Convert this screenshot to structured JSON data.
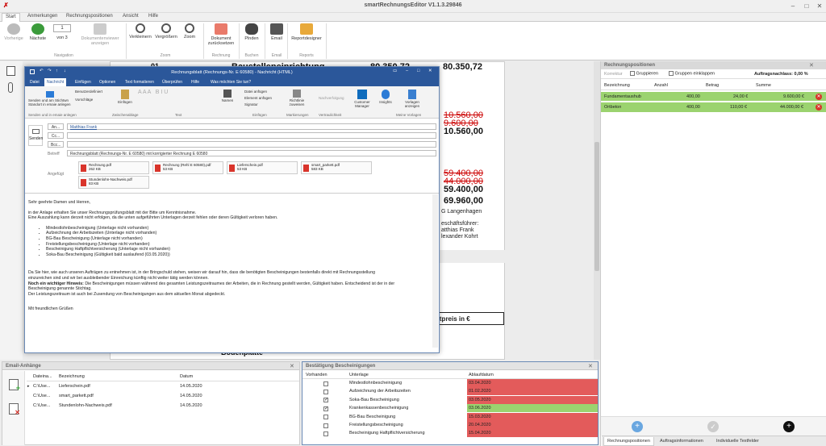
{
  "app": {
    "title": "smartRechnungsEditor  V1.1.3.29846"
  },
  "menu": [
    "Start",
    "Anmerkungen",
    "Rechnungspositionen",
    "Ansicht",
    "Hilfe"
  ],
  "ribbon": {
    "buttons": [
      "Vorherige",
      "Nächste",
      "von 3",
      "Dokumentenviewer anzeigen",
      "Verkleinern",
      "Vergrößern",
      "Zoom",
      "Dokument zurücksetzen",
      "Plnden",
      "Email",
      "Reportdesigner"
    ],
    "page_value": "1",
    "groups": [
      "Navigation",
      "Zoom",
      "Rechnung",
      "Buchen",
      "Email",
      "Reports"
    ]
  },
  "document": {
    "line1_pos": "01",
    "line1_text": "Baustelleneinrichtung",
    "line1_val1": "80.350,72",
    "line1_val2": "80.350,72",
    "v1": "10.560,00",
    "v1_strike": "9.600,00",
    "v1_total": "10.560,00",
    "v2": "59.400,00",
    "v2_strike": "44.000,00",
    "v2_total": "59.400,00",
    "v3": "69.960,00",
    "addr1": "G Langenhagen",
    "addr2": "eschäftsführer:",
    "addr3": "atthias Frank",
    "addr4": "lexander Kohrt",
    "preis": "ntpreis in €",
    "bodenplatte": "Bodenplatte"
  },
  "outlook": {
    "title": "Rechnungsblatt (Rechnungs-Nr. E 60580)  -  Nachricht (HTML)",
    "tabs": [
      "Datei",
      "Nachricht",
      "Einfügen",
      "Optionen",
      "Text formatieren",
      "Überprüfen",
      "Hilfe",
      "Was möchten Sie tun?"
    ],
    "ribbon_items": [
      "Senden und am Stichtwn Standort in emaie anlegen",
      "Benutzerdefiniert",
      "Vorschläge",
      "Einfügen",
      "Namen",
      "Datei anfügen",
      "Element anfügen",
      "Signatur",
      "Richtlinie zuweisen",
      "Nachverfolgung",
      "Customer Manager",
      "Insights",
      "Vorlagen anzeigen"
    ],
    "ribbon_groups": [
      "Senden und in emaie anlegen",
      "Zwischenablage",
      "Text",
      "Einfügen",
      "Markierungen",
      "Vertraulichkeit",
      "Meine Vorlagen"
    ],
    "send_label": "Senden",
    "to_label": "An...",
    "cc_label": "Cc...",
    "bcc_label": "Bcc...",
    "subject_label": "Betreff",
    "attach_label": "Angefügt",
    "to_value": "Matthias Frank",
    "subject_value": "Rechnungsblatt (Rechnungs-Nr. E 60580) mit korrigierter Rechnung E 60580",
    "attachments": [
      {
        "name": "Rechnung.pdf",
        "size": "262 KB"
      },
      {
        "name": "Rechnung (Rehl E 60580).pdf",
        "size": "53 KB"
      },
      {
        "name": "Lieferschein.pdf",
        "size": "53 KB"
      },
      {
        "name": "smart_parkett.pdf",
        "size": "583 KB"
      },
      {
        "name": "Stundenlohn-Nachweis.pdf",
        "size": "83 KB"
      }
    ],
    "body": {
      "greeting": "Sehr geehrte Damen und Herren,",
      "p1": "in der Anlage erhalten Sie unser Rechnungsprüfungsblatt mit der Bitte um Kenntnisnahme.",
      "p2": "Eine Auszahlung kann derzeit nicht erfolgen, da die unten aufgeführten Unterlagen derzeit fehlen oder deren Gültigkeit verloren haben.",
      "bullets": [
        "Mindestlohnbescheinigung (Unterlage nicht vorhanden)",
        "Aufzeichnung der Arbeitszeiten (Unterlage nicht vorhanden)",
        "BG-Bau Bescheinigung (Unterlage nicht vorhanden)",
        "Freistellungsbescheinigung (Unterlage nicht vorhanden)",
        "Bescheinigung Haftpflichtversicherung (Unterlage nicht vorhanden)",
        "Soka-Bau Bescheinigung (Gültigkeit bald auslaufend (03.05.2020))"
      ],
      "p3": "Da Sie hier, wie auch unseren Aufträgen zu entnehmen ist, in der Bringschuld stehen, weisen wir darauf hin, dass die benötigten Bescheinigungen bestenfalls direkt mit Rechnungsstellung",
      "p4": "einzureichen sind und wir bei ausbleibender Einreichung künftig nicht weiter tätig werden können.",
      "p5_bold": "Noch ein wichtiger Hinweis:",
      "p5": " Die Bescheinigungen müssen während des gesamten Leistungszeitraumes der Arbeiten, die in Rechnung gestellt werden, Gültigkeit haben. Entscheidend ist der in der",
      "p6": "Bescheinigung genannte Stichtag.",
      "p7": "Der Leistungszeitraum ist auch bei Zusendung von Bescheinigungen aus dem aktuellen Monat abgedeckt.",
      "closing": "Mit freundlichen Grüßen"
    }
  },
  "rechnungspositionen": {
    "title": "Rechnungspositionen",
    "toolbar": [
      "Korrektur",
      "Gruppieren",
      "Gruppen einklappen"
    ],
    "nachlass": "Auftragsnachlass: 0,00 %",
    "columns": [
      "Bezeichnung",
      "Anzahl",
      "Betrag",
      "Summe"
    ],
    "rows": [
      {
        "name": "Fundamentaushub",
        "anzahl": "400,00",
        "betrag": "24,00 €",
        "summe": "9.600,00 €"
      },
      {
        "name": "Ortbeton",
        "anzahl": "400,00",
        "betrag": "110,00 €",
        "summe": "44.000,00 €"
      }
    ],
    "tabs": [
      "Rechnungspositionen",
      "Auftragsinformationen",
      "Individuelle Textfelder"
    ]
  },
  "email_anhaenge": {
    "title": "Email-Anhänge",
    "columns": [
      "Dateina...",
      "Bezeichnung",
      "Datum"
    ],
    "rows": [
      {
        "file": "C:\\Use...",
        "name": "Lieferschein.pdf",
        "date": "14.05.2020"
      },
      {
        "file": "C:\\Use...",
        "name": "smart_parkett.pdf",
        "date": "14.05.2020"
      },
      {
        "file": "C:\\Use...",
        "name": "Stundenlohn-Nachweis.pdf",
        "date": "14.05.2020"
      }
    ]
  },
  "bestaetigung": {
    "title": "Bestätigung Bescheinigungen",
    "columns": [
      "Vorhanden",
      "Unterlage",
      "Ablaufdatum"
    ],
    "rows": [
      {
        "checked": false,
        "name": "Mindestlohnbescheinigung",
        "date": "03.04.2020",
        "status": "red"
      },
      {
        "checked": false,
        "name": "Aufzeichnung der Arbeitszeiten",
        "date": "01.02.2020",
        "status": "red"
      },
      {
        "checked": true,
        "name": "Soka-Bau Bescheinigung",
        "date": "03.05.2020",
        "status": "red"
      },
      {
        "checked": true,
        "name": "Krankenkassenbescheinigung",
        "date": "03.06.2020",
        "status": "green"
      },
      {
        "checked": false,
        "name": "BG-Bau Bescheinigung",
        "date": "15.03.2020",
        "status": "red"
      },
      {
        "checked": false,
        "name": "Freistellungsbescheinigung",
        "date": "20.04.2020",
        "status": "red"
      },
      {
        "checked": false,
        "name": "Bescheinigung Haftpflichtversicherung",
        "date": "15.04.2020",
        "status": "red"
      }
    ]
  },
  "colors": {
    "outlook_blue": "#2b579a",
    "red_row": "#e35b5b",
    "green_row": "#9bd36f",
    "accent": "#2b7bd6"
  }
}
